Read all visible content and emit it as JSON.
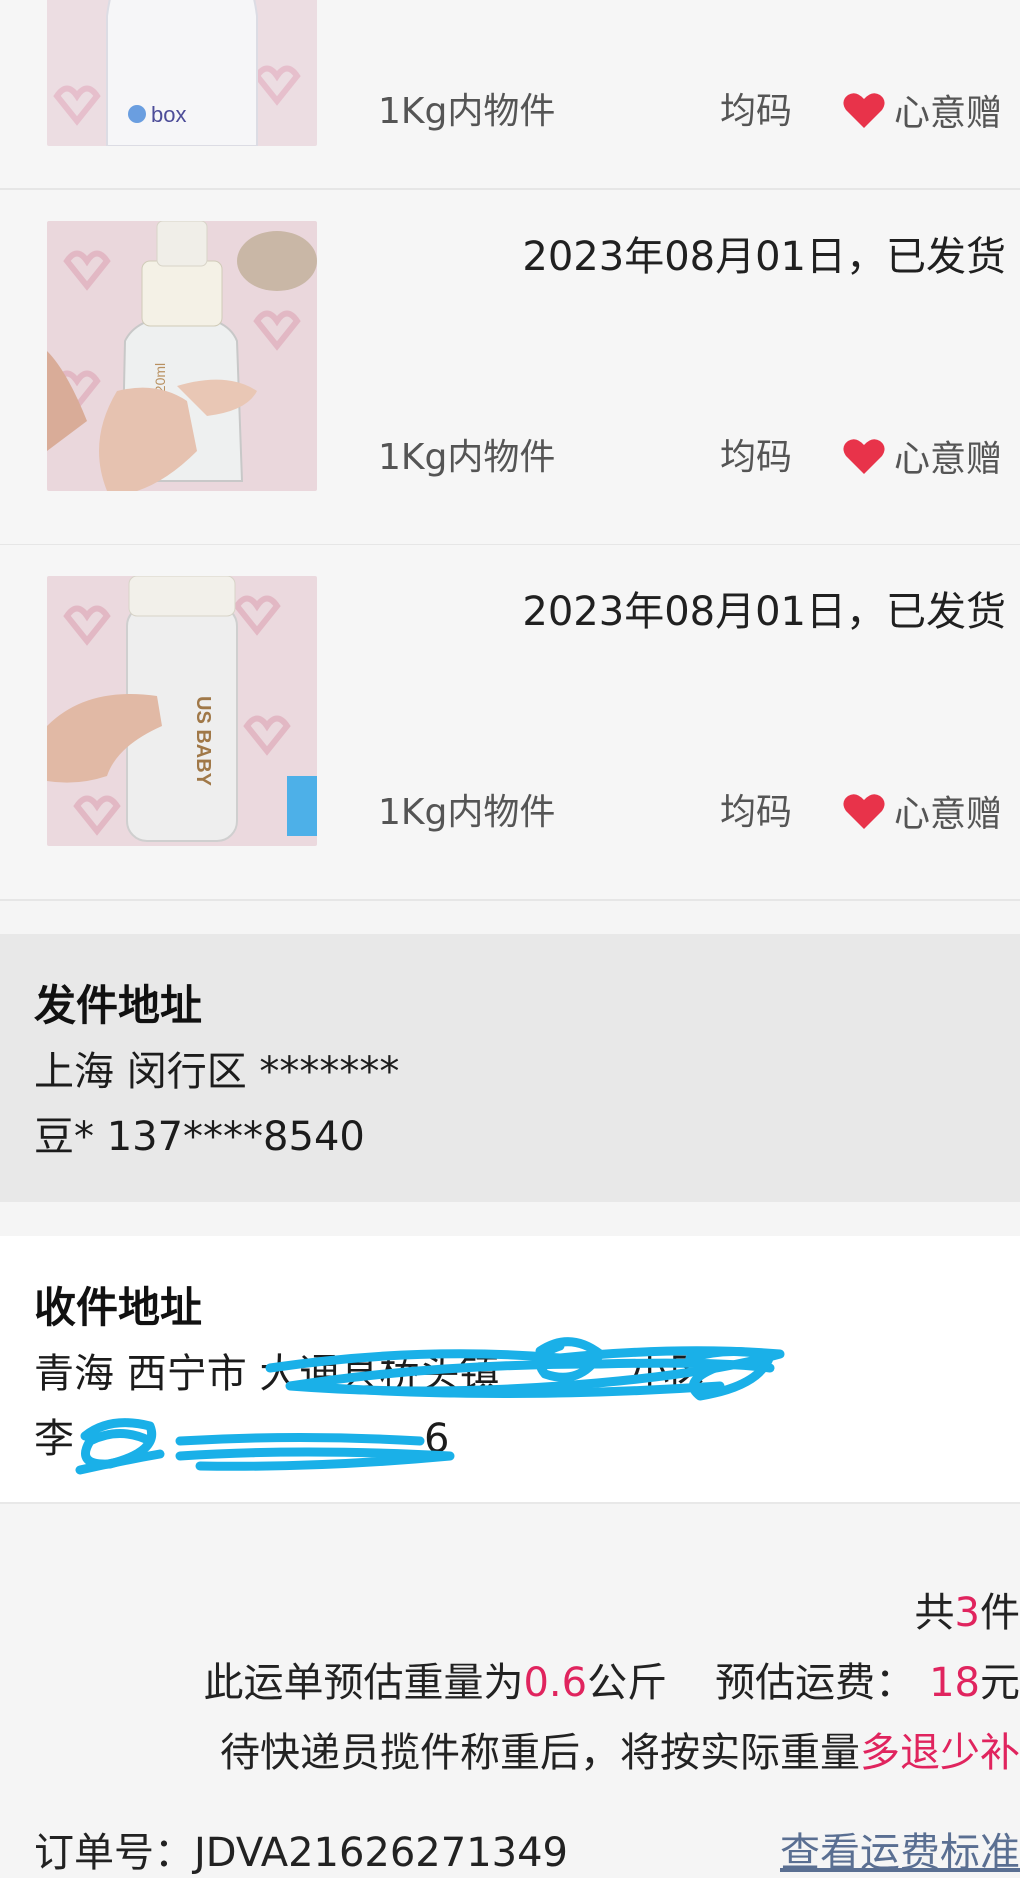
{
  "items": [
    {
      "date": "",
      "weight": "1Kg内物件",
      "size": "均码",
      "tag": "心意赠",
      "thumb_brand": "box"
    },
    {
      "date": "2023年08月01日，已发货",
      "weight": "1Kg内物件",
      "size": "均码",
      "tag": "心意赠"
    },
    {
      "date": "2023年08月01日，已发货",
      "weight": "1Kg内物件",
      "size": "均码",
      "tag": "心意赠",
      "thumb_brand": "US BABY"
    }
  ],
  "sender": {
    "title": "发件地址",
    "address": "上海 闵行区 *******",
    "contact": "豆* 137****8540"
  },
  "receiver": {
    "title": "收件地址",
    "address": "青海 西宁市 大通县桥头镇",
    "address_tail": "小区",
    "contact": "李",
    "contact_tail": "6"
  },
  "summary": {
    "count_prefix": "共",
    "count": "3",
    "count_suffix": "件",
    "weight_prefix": "此运单预估重量为",
    "weight": "0.6",
    "weight_unit": "公斤",
    "fee_prefix": "预估运费：",
    "fee": "18",
    "fee_unit": "元",
    "note_prefix": "待快递员揽件称重后，将按实际重量",
    "note_highlight": "多退少补"
  },
  "order": {
    "label": "订单号：",
    "number": "JDVA21626271349"
  },
  "fee_standard_link": "查看运费标准",
  "colors": {
    "accent": "#e0245e",
    "heart": "#e8334a",
    "scribble": "#1ab0e8",
    "link": "#5a6f92"
  }
}
